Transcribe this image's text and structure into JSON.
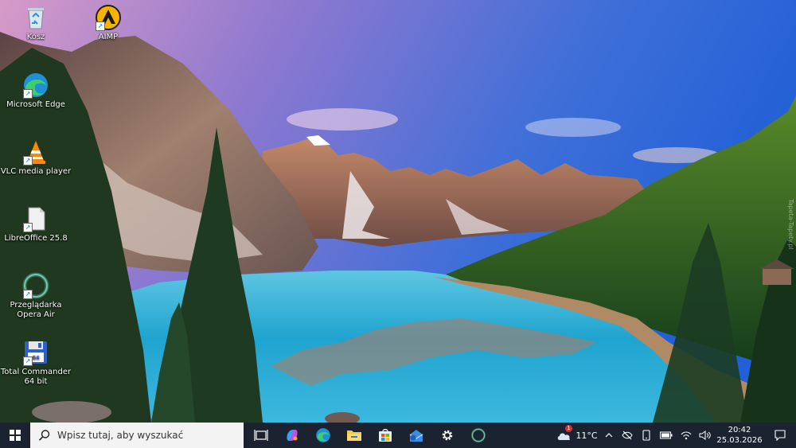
{
  "desktop": {
    "icons": [
      {
        "label": "Kosz",
        "icon": "recycle-bin-icon"
      },
      {
        "label": "AIMP",
        "icon": "aimp-icon"
      },
      {
        "label": "Microsoft Edge",
        "icon": "edge-icon"
      },
      {
        "label": "VLC media player",
        "icon": "vlc-cone-icon"
      },
      {
        "label": "LibreOffice 25.8",
        "icon": "libreoffice-icon"
      },
      {
        "label": "Przeglądarka Opera Air",
        "icon": "opera-air-icon"
      },
      {
        "label": "Total Commander 64 bit",
        "icon": "floppy-disk-icon"
      }
    ],
    "watermark": "Tapeta-Tapety.pl"
  },
  "taskbar": {
    "search_placeholder": "Wpisz tutaj, aby wyszukać",
    "pinned": [
      "task-view-icon",
      "copilot-icon",
      "edge-icon",
      "file-explorer-icon",
      "microsoft-store-icon",
      "mail-icon",
      "settings-gear-icon",
      "opera-air-icon"
    ],
    "weather": {
      "temp": "11°C",
      "badge": "1"
    },
    "clock": {
      "time": "20:42",
      "date": "25.03.2026"
    }
  },
  "colors": {
    "taskbar_bg": "#1b2330",
    "search_bg": "#f3f3f3",
    "accent": "#0078d4"
  }
}
